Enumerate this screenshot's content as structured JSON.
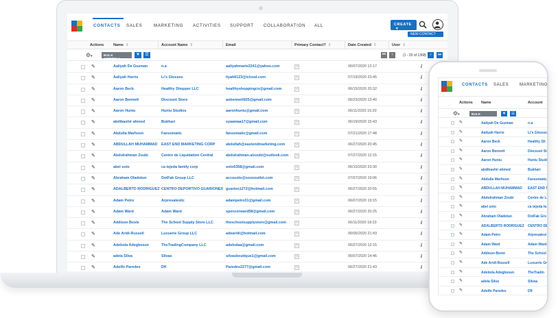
{
  "nav": {
    "tabs": [
      "CONTACTS",
      "SALES",
      "MARKETING",
      "ACTIVITIES",
      "SUPPORT",
      "COLLABORATION",
      "ALL"
    ],
    "active_tab": "CONTACTS",
    "create_label": "CREATE",
    "new_contact_label": "NEW CONTACT"
  },
  "columns": [
    "Actions",
    "Name",
    "Account Name",
    "Email",
    "Primary Contact?",
    "Date Created",
    "User"
  ],
  "toolbar": {
    "bulk_action_label": "BULK ACTION",
    "pagination": "(1 - 20 of 1368)"
  },
  "rows": [
    {
      "name": "Aaliyah De Guzman",
      "account": "n.a",
      "email": "aaliyahmarie2241@yahoo.com",
      "date": "06/07/2020 12:17"
    },
    {
      "name": "Aaliyah Harris",
      "account": "Li's Glosses",
      "email": "liyah6123@icloud.com",
      "date": "07/19/2020 23:45"
    },
    {
      "name": "Aaron Beck",
      "account": "Healthy Shopper LLC",
      "email": "healthyshoppingco@gmail.com",
      "date": "06/15/2020 20:32"
    },
    {
      "name": "Aaron Bennett",
      "account": "Discount Store",
      "email": "aobennett925@gmail.com",
      "date": "06/23/2020 13:40"
    },
    {
      "name": "Aaron Huniu",
      "account": "Huniu Studios",
      "email": "aaronhuniu@gmail.com",
      "date": "06/11/2020 15:20"
    },
    {
      "name": "abdibashir ahmed",
      "account": "Bukhari",
      "email": "syaamaa17@gmail.com",
      "date": "06/19/2020 15:43"
    },
    {
      "name": "Abdulla Marhoon",
      "account": "Fansomatic",
      "email": "fansomatic@gmail.com",
      "date": "07/21/2020 17:48"
    },
    {
      "name": "ABDULLAH MUHAMMAD",
      "account": "EAST END MARKETING CORP",
      "email": "abdullah@eastendmarketing.com",
      "date": "06/27/2020 20:45"
    },
    {
      "name": "Abdulrahman Zoubi",
      "account": "Centre de Liquidation Central",
      "email": "abdulrahman.alzoubi@outlook.com",
      "date": "07/27/2020 12:15"
    },
    {
      "name": "abel soto",
      "account": "ca tejeda family corp",
      "email": "soto5358@gmail.com",
      "date": "06/10/2020 23:30"
    },
    {
      "name": "Abraham Oladotun",
      "account": "DotFak Group LLC",
      "email": "accounts@sozooutlet.com",
      "date": "07/07/2020 19:06"
    },
    {
      "name": "ADALBERTO RODRIGUEZ",
      "account": "CENTRO DEPORTIVO GUARIONEX",
      "email": "guarion1272@hotmail.com",
      "date": "06/27/2020 20:55"
    },
    {
      "name": "Adam Petro",
      "account": "Arpresaleslic",
      "email": "adampetro31@gmail.com",
      "date": "06/07/2020 19:15"
    },
    {
      "name": "Adam Ward",
      "account": "Adam Ward",
      "email": "spencerward58@gmail.com",
      "date": "06/27/2020 20:25"
    },
    {
      "name": "Addison Beste",
      "account": "The School Supply Store LLC",
      "email": "theschoolsupplystore@gmail.com",
      "date": "06/11/2020 18:23"
    },
    {
      "name": "Ade Aridi-Russell",
      "account": "Luxuerie Group LLC",
      "email": "adearidi@hotmail.com",
      "date": "06/05/2020 21:43"
    },
    {
      "name": "Adebola Adegbesun",
      "account": "TheTradingCompany LLC",
      "email": "adebolaa@gmail.com",
      "date": "06/27/2020 12:15"
    },
    {
      "name": "adela Silva",
      "account": "Silvas",
      "email": "silvasboutique1@gmail.com",
      "date": "06/07/2020 14:46"
    },
    {
      "name": "Adolfo Paredes",
      "account": "Dlf",
      "email": "Paredes2277@gmail.com",
      "date": "06/27/2020 21:43"
    }
  ],
  "phone": {
    "tabs": [
      "CONTACTS",
      "SALES",
      "MARKETING"
    ],
    "columns": [
      "Actions",
      "Name",
      "Account"
    ],
    "bulk_action_label": "BULK ACTION",
    "rows": [
      {
        "name": "Aaliyah De Guzman",
        "account": "n.a"
      },
      {
        "name": "Aaliyah Harris",
        "account": "Li's Glosses"
      },
      {
        "name": "Aaron Beck",
        "account": "Healthy Sh"
      },
      {
        "name": "Aaron Bennett",
        "account": "Discount Sto"
      },
      {
        "name": "Aaron Huniu",
        "account": "Huniu Studi"
      },
      {
        "name": "abdibashir ahmed",
        "account": "Bukhari"
      },
      {
        "name": "Abdulla Marhoon",
        "account": "Fansomatic"
      },
      {
        "name": "ABDULLAH MUHAMMAD",
        "account": "EAST END M"
      },
      {
        "name": "Abdulrahman Zoubi",
        "account": "Centre de Li"
      },
      {
        "name": "abel soto",
        "account": "ca tejeda fa"
      },
      {
        "name": "Abraham Oladotun",
        "account": "DotFak Gro"
      },
      {
        "name": "ADALBERTO RODRIGUEZ",
        "account": "CENTRO DE"
      },
      {
        "name": "Adam Petro",
        "account": "Arpresalesl"
      },
      {
        "name": "Adam Ward",
        "account": "Adam Ward"
      },
      {
        "name": "Addison Beste",
        "account": "The School"
      },
      {
        "name": "Ade Aridi-Russell",
        "account": "Luxuerie Gr"
      },
      {
        "name": "Adebola Adegbesun",
        "account": "TheTradin"
      },
      {
        "name": "adela Silva",
        "account": "Silvas"
      },
      {
        "name": "Adolfo Paredes",
        "account": "Dlf"
      }
    ]
  },
  "colors": {
    "accent": "#1a6fc4",
    "logo": [
      "#1a6fc4",
      "#f4b400",
      "#d93025",
      "#33a852"
    ]
  }
}
